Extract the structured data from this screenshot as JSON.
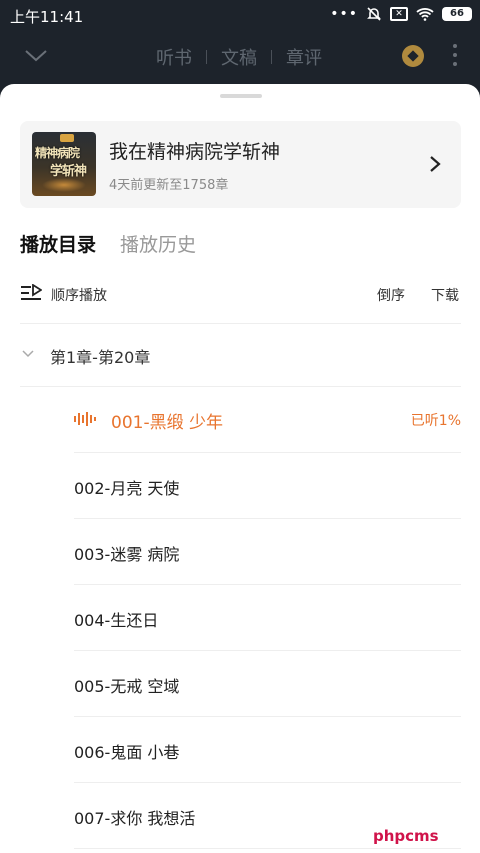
{
  "status": {
    "time": "上午11:41",
    "battery": "66"
  },
  "topnav": {
    "tabs": [
      "听书",
      "文稿",
      "章评"
    ]
  },
  "book": {
    "title": "我在精神病院学斩神",
    "update": "4天前更新至1758章",
    "cover_text_1": "精神病院",
    "cover_text_2": "学斩神"
  },
  "play_tabs": [
    "播放目录",
    "播放历史"
  ],
  "toolbar": {
    "order": "顺序播放",
    "reverse": "倒序",
    "download": "下载"
  },
  "group": {
    "label": "第1章-第20章"
  },
  "chapters": [
    {
      "title": "001-黑缎 少年",
      "progress": "已听1%"
    },
    {
      "title": "002-月亮 天使"
    },
    {
      "title": "003-迷雾 病院"
    },
    {
      "title": "004-生还日"
    },
    {
      "title": "005-无戒 空域"
    },
    {
      "title": "006-鬼面 小巷"
    },
    {
      "title": "007-求你 我想活"
    }
  ],
  "colors": {
    "accent": "#e8742e",
    "header_bg": "#1d232b"
  },
  "watermark": "phpcms"
}
